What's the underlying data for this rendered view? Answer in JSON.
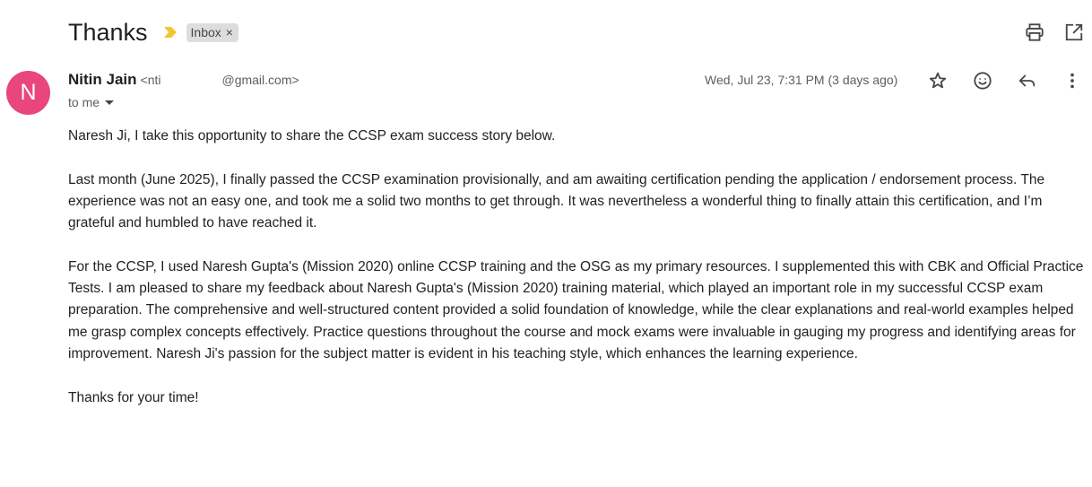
{
  "header": {
    "subject": "Thanks",
    "label": "Inbox",
    "label_remove": "×",
    "colors": {
      "importance": "#f2c530",
      "label_bg": "#dddddd"
    },
    "icons": [
      "print-icon",
      "open-in-new-window-icon"
    ]
  },
  "message": {
    "avatar_letter": "N",
    "avatar_color": "#e8467c",
    "sender_name": "Nitin Jain",
    "sender_email_prefix": "<nti",
    "sender_email_suffix": "@gmail.com>",
    "recipient": "to me",
    "date": "Wed, Jul 23, 7:31 PM (3 days ago)",
    "action_icons": [
      "star-icon",
      "emoji-reaction-icon",
      "reply-icon",
      "more-vert-icon"
    ]
  },
  "body": {
    "greeting": "Naresh  Ji,  I take this opportunity to share the CCSP exam success story below.",
    "paragraph_1": "Last month (June 2025), I finally passed the CCSP examination provisionally, and am awaiting certification pending the application / endorsement process. The experience was not an easy one, and took me a solid two months to get through.  It was nevertheless a wonderful thing to finally attain this certification, and I’m grateful and humbled to have reached it.",
    "paragraph_2": "For the CCSP, I used Naresh Gupta's (Mission 2020) online CCSP training and the OSG as my primary resources. I supplemented this with CBK and Official Practice Tests. I am pleased to share my feedback about Naresh Gupta's (Mission 2020) training material, which played an important role in my successful CCSP exam preparation. The comprehensive and well-structured content provided a solid foundation of knowledge, while the clear explanations and real-world examples helped me grasp complex concepts effectively. Practice questions throughout the course and mock exams were invaluable in gauging my progress and identifying areas for improvement. Naresh Ji's passion for the subject matter is evident in his teaching style, which enhances the learning experience.",
    "closing": "Thanks for your time!"
  }
}
